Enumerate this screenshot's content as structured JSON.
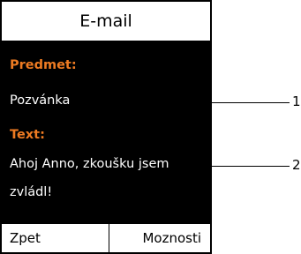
{
  "screen": {
    "title": "E-mail",
    "subject_label": "Predmet:",
    "subject_value": "Pozvánka",
    "text_label": "Text:",
    "text_line1": "Ahoj Anno, zkoušku jsem",
    "text_line2": "zvládl!"
  },
  "softkeys": {
    "left": "Zpet",
    "right": "Moznosti"
  },
  "callouts": [
    "1",
    "2"
  ],
  "colors": {
    "label_orange": "#ee7b22",
    "screen_bg": "#000000",
    "bar_bg": "#ffffff"
  }
}
